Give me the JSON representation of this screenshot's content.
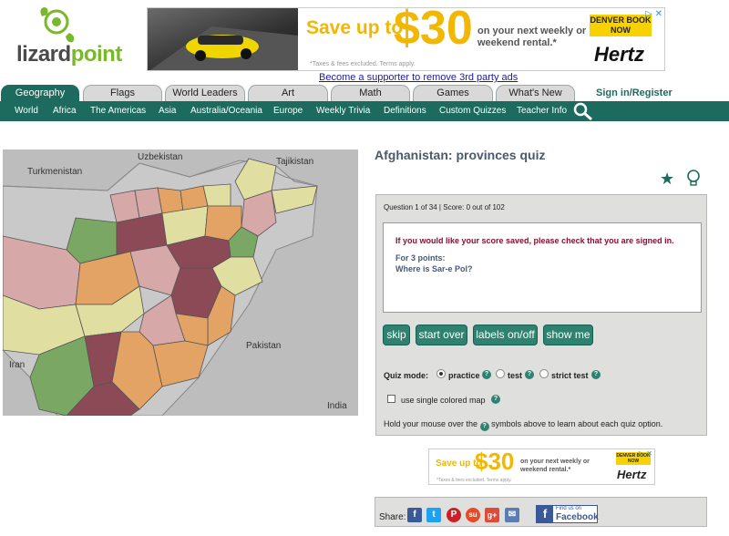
{
  "logo": {
    "text_a": "lizard",
    "text_b": "point"
  },
  "ad_top": {
    "save_text": "Save up to",
    "amount": "$30",
    "desc": "on your next weekly or weekend rental.*",
    "fine_print": "*Taxes & fees excluded. Terms apply.",
    "cta": "DENVER BOOK NOW",
    "brand": "Hertz",
    "close": "▷ ✕"
  },
  "supporter_link": "Become a supporter to remove 3rd party ads",
  "tabs": [
    "Geography",
    "Flags",
    "World Leaders",
    "Art",
    "Math",
    "Games",
    "What's New"
  ],
  "signin": "Sign in/Register",
  "nav": [
    "World",
    "Africa",
    "The Americas",
    "Asia",
    "Australia/Oceania",
    "Europe",
    "Weekly Trivia",
    "Definitions",
    "Custom Quizzes",
    "Teacher Info"
  ],
  "map_labels": {
    "turkmenistan": "Turkmenistan",
    "uzbekistan": "Uzbekistan",
    "tajikistan": "Tajikistan",
    "pakistan": "Pakistan",
    "iran": "Iran",
    "india": "India"
  },
  "quiz": {
    "title": "Afghanistan: provinces quiz",
    "status": "Question 1 of 34 | Score: 0 out of 102",
    "warning": "If you would like your score saved, please check that you are signed in.",
    "points": "For 3 points:",
    "question": "Where is Sar-e Pol?",
    "buttons": {
      "skip": "skip",
      "start_over": "start over",
      "labels": "labels on/off",
      "show_me": "show me"
    },
    "mode_label": "Quiz mode:",
    "modes": {
      "practice": "practice",
      "test": "test",
      "strict": "strict test"
    },
    "help_glyph": "?",
    "single_color": "use single colored map",
    "hint": "Hold your mouse over the",
    "hint_end": "symbols above to learn about each quiz option."
  },
  "ad_bottom": {
    "save_text": "Save up to",
    "amount": "$30",
    "desc": "on your next weekly or weekend rental.*",
    "fine_print": "*Taxes & fees excluded. Terms apply.",
    "cta": "DENVER BOOK NOW",
    "brand": "Hertz",
    "close": "▷ ✕"
  },
  "share": {
    "label": "Share:",
    "icons": [
      "f",
      "t",
      "P",
      "su",
      "g+",
      "✉"
    ],
    "fb_small": "Find us on",
    "fb_word": "Facebook"
  },
  "colors": {
    "brand_green": "#1d6a5e",
    "button": "#2e8270",
    "warning": "#8a1030",
    "question": "#445b80"
  }
}
